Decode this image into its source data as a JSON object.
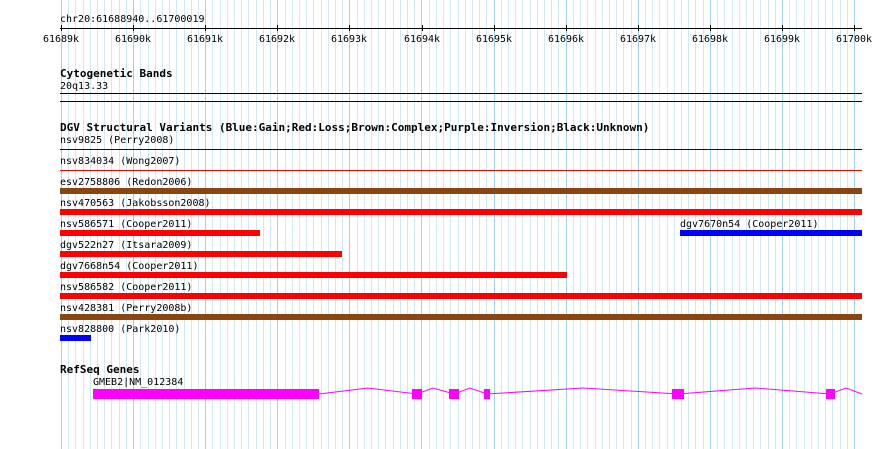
{
  "ruler": {
    "location_label": "chr20:61688940..61700019",
    "ticks": [
      "61689k",
      "61690k",
      "61691k",
      "61692k",
      "61693k",
      "61694k",
      "61695k",
      "61696k",
      "61697k",
      "61698k",
      "61699k",
      "61700k"
    ]
  },
  "cytoband": {
    "title": "Cytogenetic Bands",
    "band": "20q13.33"
  },
  "dgv": {
    "title": "DGV Structural Variants (Blue:Gain;Red:Loss;Brown:Complex;Purple:Inversion;Black:Unknown)",
    "colors": {
      "gain": "#0000ff",
      "loss": "#ff0000",
      "complex": "#8b4513",
      "inversion": "#800080",
      "unknown": "#000000"
    },
    "items": [
      {
        "label": "nsv9825 (Perry2008)",
        "type": "gain"
      },
      {
        "label": "nsv834034 (Wong2007)",
        "type": "loss"
      },
      {
        "label": "esv2758806 (Redon2006)",
        "type": "complex"
      },
      {
        "label": "nsv470563 (Jakobsson2008)",
        "type": "loss"
      },
      {
        "label": "nsv586571 (Cooper2011)",
        "type": "loss"
      },
      {
        "label": "dgv7670n54 (Cooper2011)",
        "type": "gain"
      },
      {
        "label": "dgv522n27 (Itsara2009)",
        "type": "loss"
      },
      {
        "label": "dgv7668n54 (Cooper2011)",
        "type": "loss"
      },
      {
        "label": "nsv586582 (Cooper2011)",
        "type": "loss"
      },
      {
        "label": "nsv428381 (Perry2008b)",
        "type": "complex"
      },
      {
        "label": "nsv828800 (Park2010)",
        "type": "gain"
      }
    ]
  },
  "refseq": {
    "title": "RefSeq Genes",
    "gene_label": "GMEB2|NM_012384",
    "color": "#ff00ff"
  }
}
